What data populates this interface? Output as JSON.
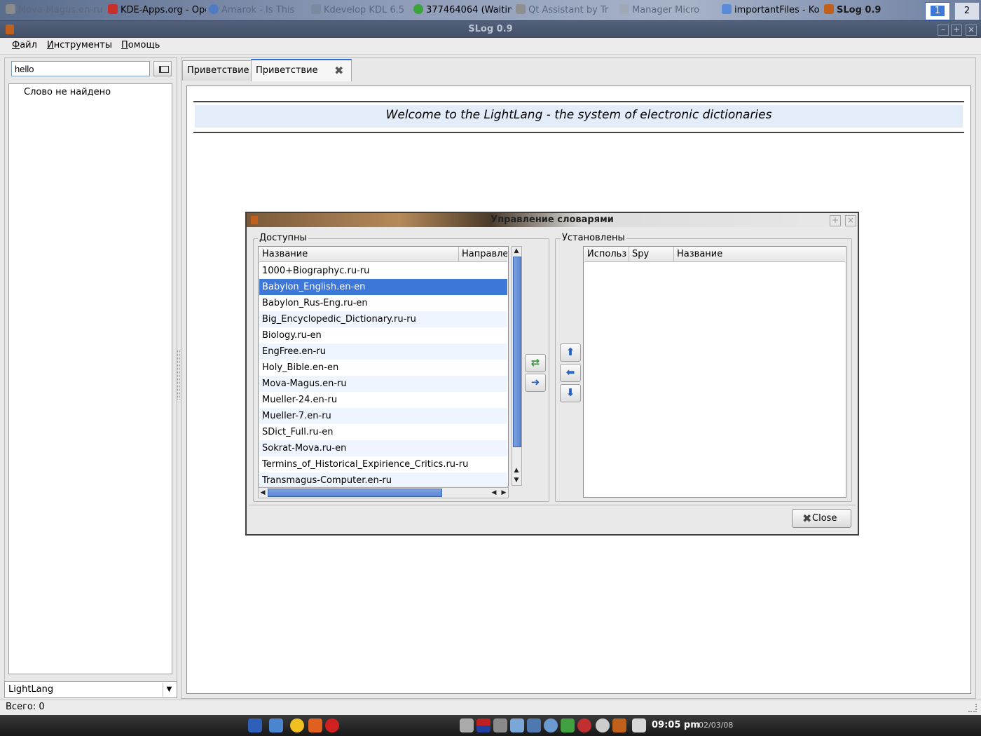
{
  "taskbar": {
    "items": [
      {
        "label": "Mova-Magus.en-ru",
        "state": "dim"
      },
      {
        "label": "KDE-Apps.org - Ope",
        "state": "normal"
      },
      {
        "label": "Amarok - Is This",
        "state": "dim"
      },
      {
        "label": "Kdevelop KDL 6.5",
        "state": "dim"
      },
      {
        "label": "377464064 (Waitin",
        "state": "normal"
      },
      {
        "label": "Qt Assistant by Tr",
        "state": "dim"
      },
      {
        "label": "Manager Micro",
        "state": "dim"
      },
      {
        "label": "importantFiles - Kon",
        "state": "normal"
      },
      {
        "label": "SLog 0.9",
        "state": "active"
      }
    ],
    "desktops": [
      "1",
      "2"
    ]
  },
  "window": {
    "title": "SLog 0.9"
  },
  "menu": {
    "file": "Файл",
    "tools": "Инструменты",
    "help": "Помощь"
  },
  "search": {
    "value": "hello",
    "not_found": "Слово не найдено"
  },
  "dict_select": {
    "value": "LightLang"
  },
  "tabs": [
    "Приветствие",
    "Приветствие"
  ],
  "welcome": {
    "text": "Welcome to the LightLang - the system of electronic dictionaries"
  },
  "status": {
    "text": "Всего: 0"
  },
  "clock": {
    "time": "09:05 pm",
    "date": "02/03/08"
  },
  "dialog": {
    "title": "Управление словарями",
    "available": {
      "title": "Доступны",
      "columns": [
        "Название",
        "Направле"
      ],
      "rows": [
        "1000+Biographyc.ru-ru",
        "Babylon_English.en-en",
        "Babylon_Rus-Eng.ru-en",
        "Big_Encyclopedic_Dictionary.ru-ru",
        "Biology.ru-en",
        "EngFree.en-ru",
        "Holy_Bible.en-en",
        "Mova-Magus.en-ru",
        "Mueller-24.en-ru",
        "Mueller-7.en-ru",
        "SDict_Full.ru-en",
        "Sokrat-Mova.ru-en",
        "Termins_of_Historical_Expirience_Critics.ru-ru",
        "Transmagus-Computer.en-ru"
      ],
      "selected_index": 1
    },
    "installed": {
      "title": "Установлены",
      "columns": [
        "Использ",
        "Spy",
        "Название"
      ]
    },
    "close_label": "Close"
  },
  "colors": {
    "selection": "#3d78d8",
    "row_alt": "#eef5fe",
    "welcome_bg": "#e3edfa"
  }
}
